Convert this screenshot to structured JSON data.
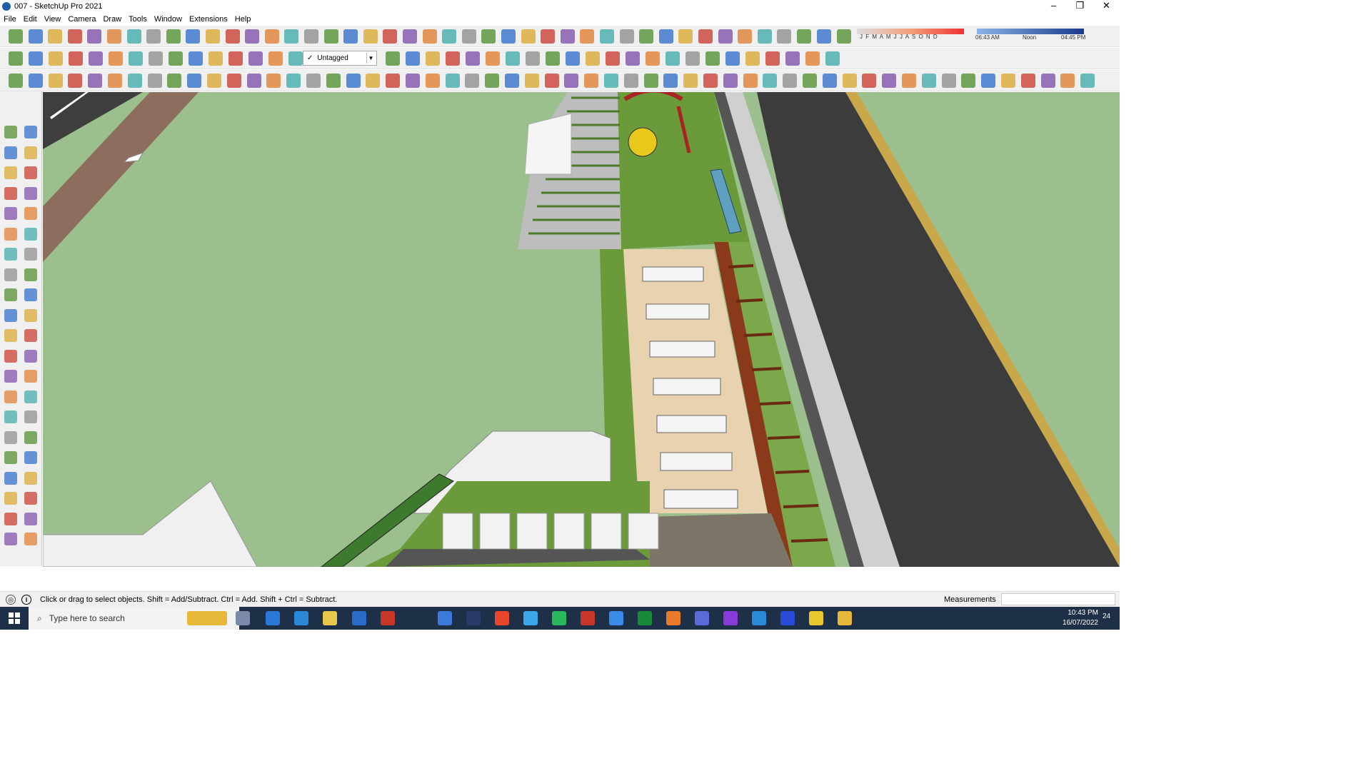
{
  "window": {
    "title": "007 - SketchUp Pro 2021",
    "minimize": "–",
    "restore": "❐",
    "close": "✕"
  },
  "menu": {
    "items": [
      "File",
      "Edit",
      "View",
      "Camera",
      "Draw",
      "Tools",
      "Window",
      "Extensions",
      "Help"
    ]
  },
  "tags_dropdown": {
    "check": "✓",
    "value": "Untagged"
  },
  "shadow_timeline": {
    "months": "J F M A M J J A S O N D",
    "time_start": "06:43 AM",
    "time_mid": "Noon",
    "time_end": "04:45 PM"
  },
  "status": {
    "info_icon": "i",
    "message": "Click or drag to select objects. Shift = Add/Subtract. Ctrl = Add. Shift + Ctrl = Subtract.",
    "measurements_label": "Measurements",
    "measurements_value": ""
  },
  "taskbar": {
    "search_placeholder": "Type here to search",
    "time": "10:43 PM",
    "date": "16/07/2022",
    "notifications": "24"
  },
  "colors": {
    "grass": "#9bbf8d",
    "road": "#3c3c3c",
    "paving": "#e8d2b0",
    "brick": "#8a3a1a",
    "curb": "#8d6e5e"
  }
}
